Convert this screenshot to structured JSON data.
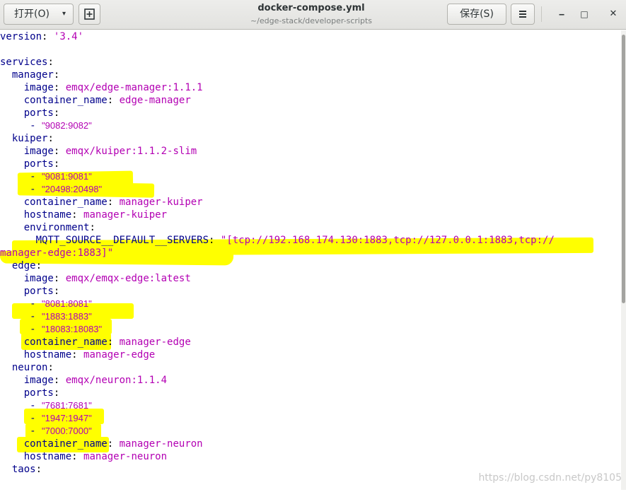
{
  "header": {
    "open_label": "打开(O)",
    "open_arrow": "▾",
    "new_icon": "new-document-icon",
    "title": "docker-compose.yml",
    "subtitle": "~/edge-stack/developer-scripts",
    "save_label": "保存(S)",
    "menu_icon": "hamburger-menu-icon",
    "min_glyph": "‒",
    "max_glyph": "□",
    "close_glyph": "✕"
  },
  "editor": {
    "lines": [
      {
        "k": "version",
        "v": "'3.4'"
      },
      {},
      {
        "k": "services"
      },
      {
        "k": "manager",
        "i": "  "
      },
      {
        "k": "image",
        "v": "emqx/edge-manager:1.1.1",
        "i": "    "
      },
      {
        "k": "container_name",
        "v": "edge-manager",
        "i": "    "
      },
      {
        "k": "ports",
        "i": "    "
      },
      {
        "item": "\"9082:9082\"",
        "i": "     "
      },
      {
        "k": "kuiper",
        "i": "  "
      },
      {
        "k": "image",
        "v": "emqx/kuiper:1.1.2-slim",
        "i": "    "
      },
      {
        "k": "ports",
        "i": "    "
      },
      {
        "item": "\"9081:9081\"",
        "i": "     "
      },
      {
        "item": "\"20498:20498\"",
        "i": "     "
      },
      {
        "k": "container_name",
        "v": "manager-kuiper",
        "i": "    "
      },
      {
        "k": "hostname",
        "v": "manager-kuiper",
        "i": "    "
      },
      {
        "k": "environment",
        "i": "    "
      },
      {
        "k": "MQTT_SOURCE__DEFAULT__SERVERS",
        "v": "\"[tcp://192.168.174.130:1883,tcp://127.0.0.1:1883,tcp://",
        "i": "      "
      },
      {
        "raw": "manager-edge:1883]\""
      },
      {
        "k": "edge",
        "i": "  "
      },
      {
        "k": "image",
        "v": "emqx/emqx-edge:latest",
        "i": "    "
      },
      {
        "k": "ports",
        "i": "    "
      },
      {
        "item": "\"8081:8081\"",
        "i": "     "
      },
      {
        "item": "\"1883:1883\"",
        "i": "     "
      },
      {
        "item": "\"18083:18083\"",
        "i": "     "
      },
      {
        "k": "container_name",
        "v": "manager-edge",
        "i": "    "
      },
      {
        "k": "hostname",
        "v": "manager-edge",
        "i": "    "
      },
      {
        "k": "neuron",
        "i": "  "
      },
      {
        "k": "image",
        "v": "emqx/neuron:1.1.4",
        "i": "    "
      },
      {
        "k": "ports",
        "i": "    "
      },
      {
        "item": "\"7681:7681\"",
        "i": "     "
      },
      {
        "item": "\"1947:1947\"",
        "i": "     "
      },
      {
        "item": "\"7000:7000\"",
        "i": "     "
      },
      {
        "k": "container_name",
        "v": "manager-neuron",
        "i": "    "
      },
      {
        "k": "hostname",
        "v": "manager-neuron",
        "i": "    "
      },
      {
        "k": "taos",
        "i": "  "
      }
    ]
  },
  "watermark": "https://blog.csdn.net/py8105",
  "colors": {
    "key": "#00008b",
    "value": "#b300b3",
    "highlight": "#ffff00"
  }
}
